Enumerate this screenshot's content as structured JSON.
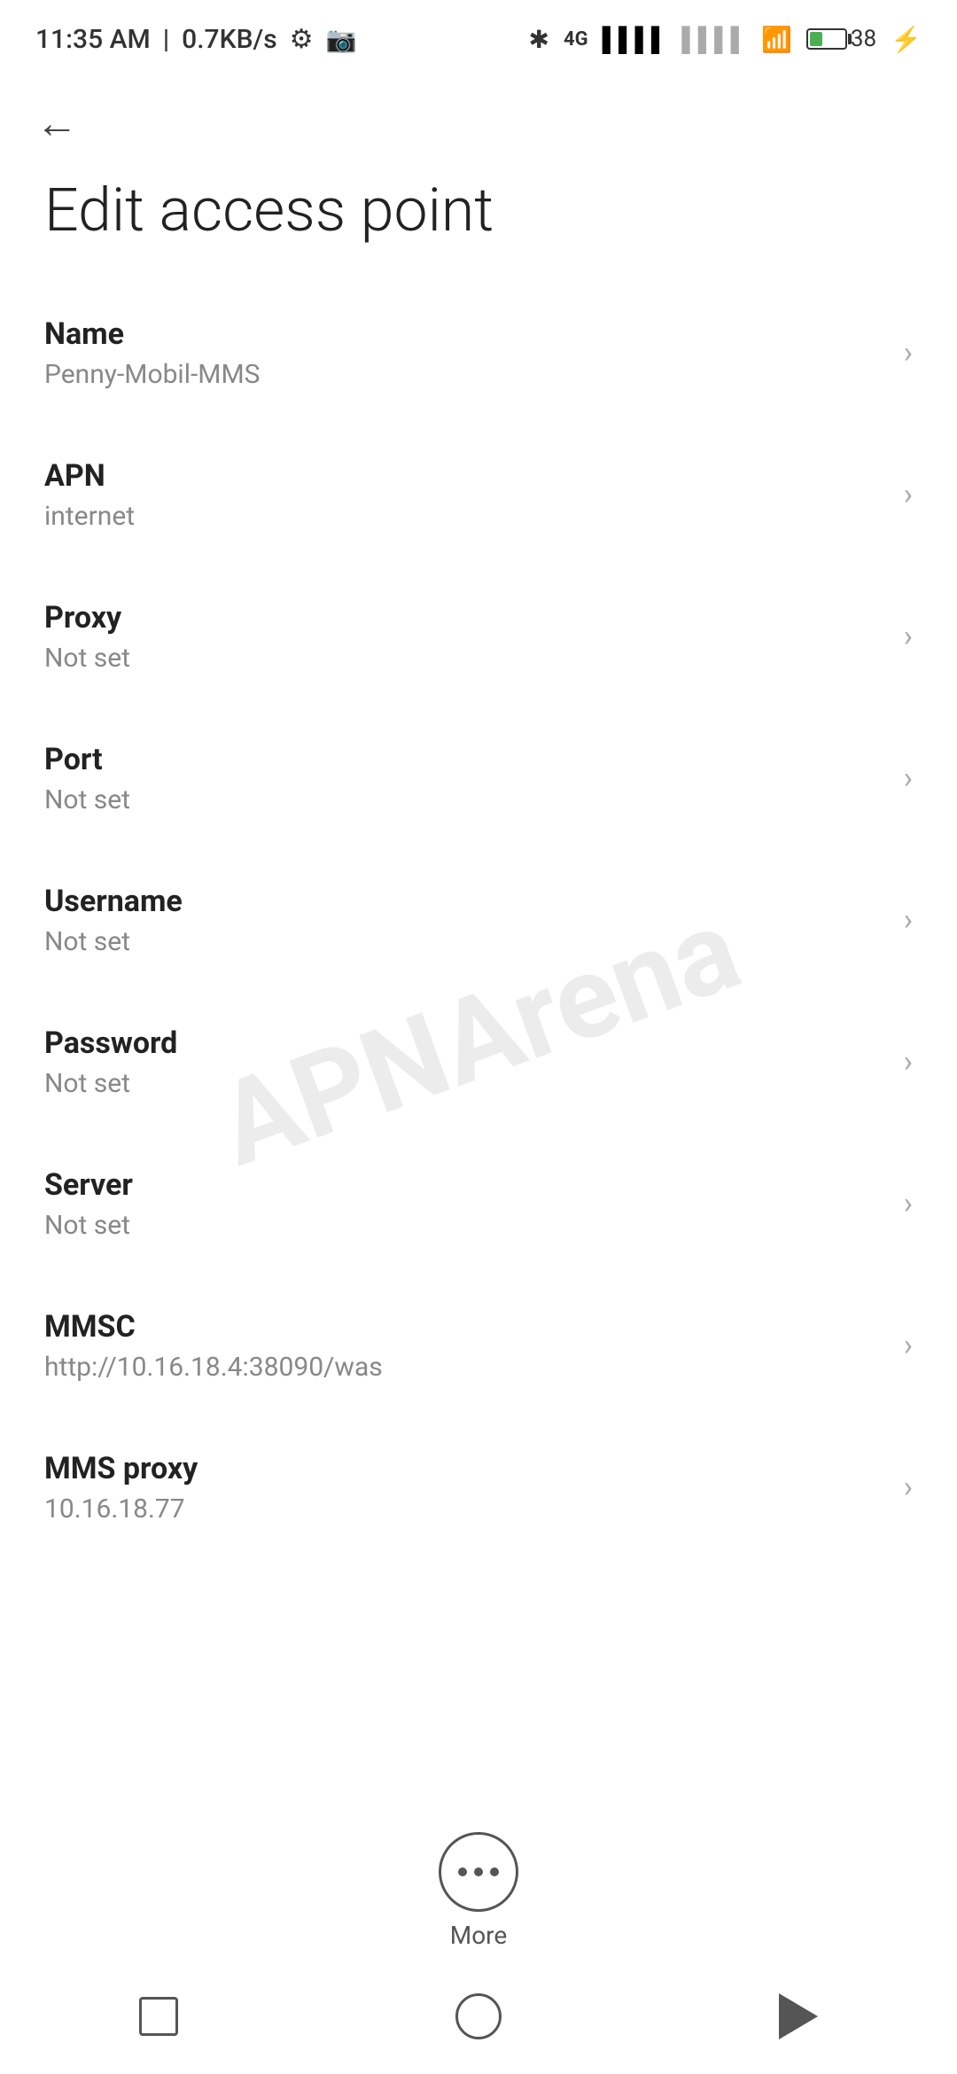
{
  "statusBar": {
    "time": "11:35 AM",
    "speed": "0.7KB/s"
  },
  "page": {
    "title": "Edit access point"
  },
  "fields": [
    {
      "id": "name",
      "label": "Name",
      "value": "Penny-Mobil-MMS"
    },
    {
      "id": "apn",
      "label": "APN",
      "value": "internet"
    },
    {
      "id": "proxy",
      "label": "Proxy",
      "value": "Not set"
    },
    {
      "id": "port",
      "label": "Port",
      "value": "Not set"
    },
    {
      "id": "username",
      "label": "Username",
      "value": "Not set"
    },
    {
      "id": "password",
      "label": "Password",
      "value": "Not set"
    },
    {
      "id": "server",
      "label": "Server",
      "value": "Not set"
    },
    {
      "id": "mmsc",
      "label": "MMSC",
      "value": "http://10.16.18.4:38090/was"
    },
    {
      "id": "mms-proxy",
      "label": "MMS proxy",
      "value": "10.16.18.77"
    }
  ],
  "more": {
    "label": "More"
  },
  "watermark": "APNArena"
}
